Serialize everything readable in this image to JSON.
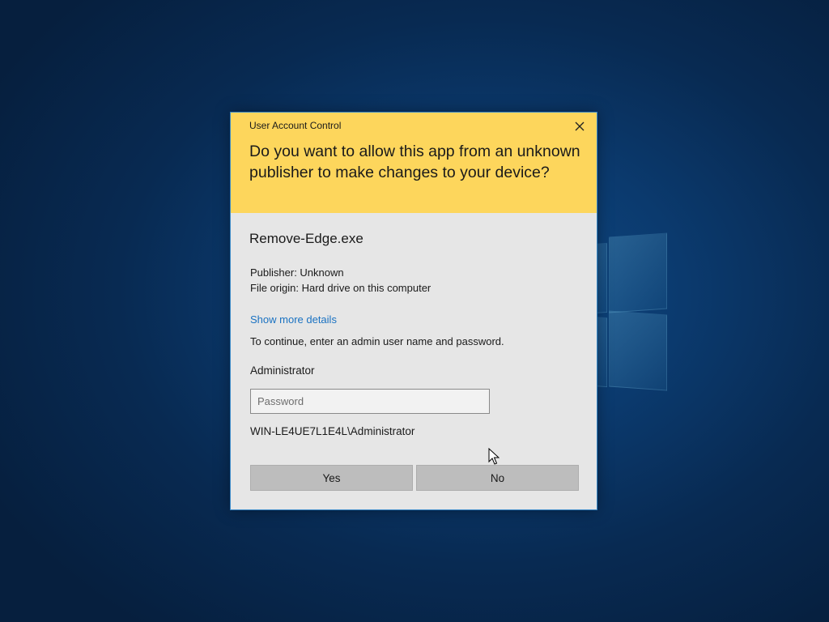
{
  "dialog": {
    "title": "User Account Control",
    "question": "Do you want to allow this app from an unknown publisher to make changes to your device?",
    "app_name": "Remove-Edge.exe",
    "publisher": "Publisher: Unknown",
    "file_origin": "File origin: Hard drive on this computer",
    "details_link": "Show more details",
    "continue_text": "To continue, enter an admin user name and password.",
    "user_label": "Administrator",
    "password": {
      "value": "",
      "placeholder": "Password"
    },
    "domain_user": "WIN-LE4UE7L1E4L\\Administrator",
    "buttons": {
      "yes": "Yes",
      "no": "No"
    }
  },
  "icons": {
    "close": "close-icon",
    "cursor": "mouse-pointer-icon",
    "logo": "windows-logo-icon"
  },
  "colors": {
    "header": "#fdd65c",
    "body": "#e6e6e6",
    "border": "#3b8ac8",
    "link": "#1a72c2",
    "button": "#bdbdbd",
    "desktop": "#0b3a6e"
  }
}
